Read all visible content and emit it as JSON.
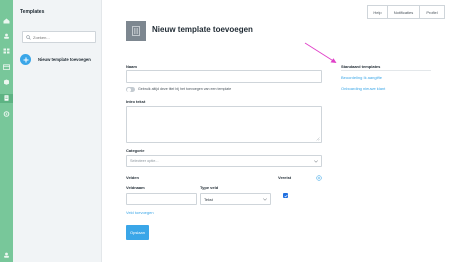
{
  "sidebar": {
    "title": "Templates",
    "search_placeholder": "Zoeken...",
    "add_label": "Nieuw template toevoegen"
  },
  "nav_icons": [
    "home-icon",
    "users-icon",
    "grid-icon",
    "calendar-icon",
    "box-icon",
    "document-icon",
    "settings-icon",
    "user-icon"
  ],
  "top_buttons": {
    "help": "Help",
    "notifications": "Notificaties",
    "profile": "Profiel"
  },
  "header": {
    "title": "Nieuw template toevoegen"
  },
  "form": {
    "name_label": "Naam",
    "toggle_label": "Gebruik altijd deze titel bij het toevoegen van een template",
    "intro_label": "Intro tekst",
    "category_label": "Categorie",
    "category_placeholder": "Selecteer optie...",
    "fields_label": "Velden",
    "required_label": "Vereist",
    "field_name_label": "Veldnaam",
    "field_type_label": "Type veld",
    "field_type_value": "Tekst",
    "add_field_link": "Veld toevoegen",
    "save_button": "Opslaan"
  },
  "standard_templates": {
    "title": "Standaard templates",
    "items": [
      "Beoordeling Ik aangifte",
      "Onboarding nieuwe klant"
    ]
  },
  "colors": {
    "accent": "#3aa6e8",
    "rail": "#78c79a",
    "annotation_arrow": "#e040c8"
  }
}
